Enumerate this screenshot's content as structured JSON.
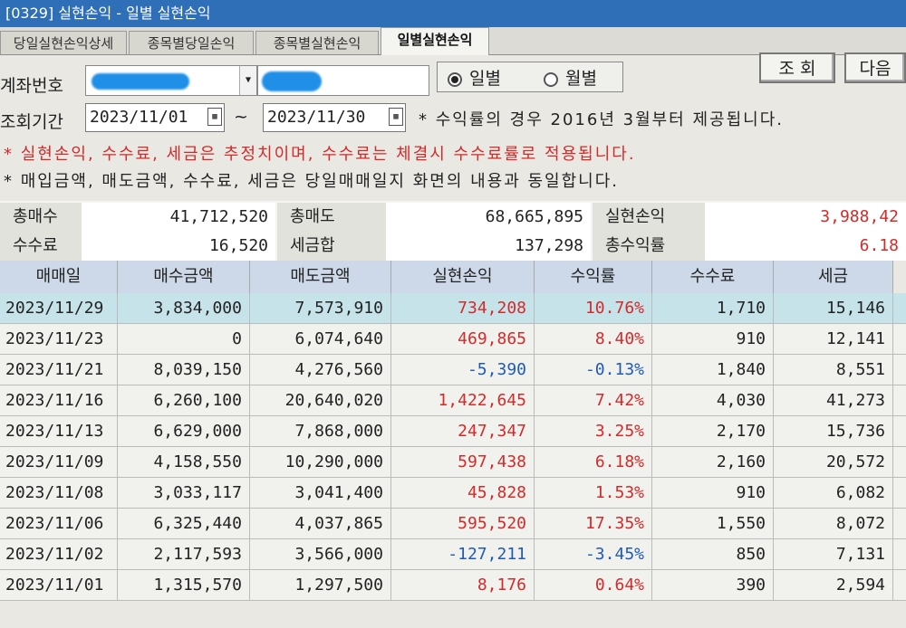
{
  "window": {
    "title": "[0329] 실현손익 - 일별 실현손익"
  },
  "tabs": [
    {
      "label": "당일실현손익상세",
      "active": false
    },
    {
      "label": "종목별당일손익",
      "active": false
    },
    {
      "label": "종목별실현손익",
      "active": false
    },
    {
      "label": "일별실현손익",
      "active": true
    }
  ],
  "form": {
    "account_label": "계좌번호",
    "period_label": "조회기간",
    "date_from": "2023/11/01",
    "date_sep": "~",
    "date_to": "2023/11/30",
    "radio_daily": "일별",
    "radio_monthly": "월별",
    "search_button": "조 회",
    "next_button": "다음",
    "note_yield": "* 수익률의 경우 2016년 3월부터 제공됩니다.",
    "note_realized": "* 실현손익, 수수료, 세금은 추정치이며, 수수료는 체결시 수수료률로 적용됩니다.",
    "note_amounts": "* 매입금액, 매도금액, 수수료, 세금은 당일매매일지 화면의 내용과 동일합니다."
  },
  "summary": {
    "total_buy_label": "총매수",
    "total_buy": "41,712,520",
    "total_sell_label": "총매도",
    "total_sell": "68,665,895",
    "realized_label": "실현손익",
    "realized": "3,988,42",
    "fee_label": "수수료",
    "fee": "16,520",
    "tax_label": "세금합",
    "tax": "137,298",
    "yield_label": "총수익률",
    "yield": "6.18"
  },
  "table": {
    "headers": [
      "매매일",
      "매수금액",
      "매도금액",
      "실현손익",
      "수익률",
      "수수료",
      "세금"
    ],
    "rows": [
      [
        "2023/11/29",
        "3,834,000",
        "7,573,910",
        "734,208",
        "10.76%",
        "1,710",
        "15,146"
      ],
      [
        "2023/11/23",
        "0",
        "6,074,640",
        "469,865",
        "8.40%",
        "910",
        "12,141"
      ],
      [
        "2023/11/21",
        "8,039,150",
        "4,276,560",
        "-5,390",
        "-0.13%",
        "1,840",
        "8,551"
      ],
      [
        "2023/11/16",
        "6,260,100",
        "20,640,020",
        "1,422,645",
        "7.42%",
        "4,030",
        "41,273"
      ],
      [
        "2023/11/13",
        "6,629,000",
        "7,868,000",
        "247,347",
        "3.25%",
        "2,170",
        "15,736"
      ],
      [
        "2023/11/09",
        "4,158,550",
        "10,290,000",
        "597,438",
        "6.18%",
        "2,160",
        "20,572"
      ],
      [
        "2023/11/08",
        "3,033,117",
        "3,041,400",
        "45,828",
        "1.53%",
        "910",
        "6,082"
      ],
      [
        "2023/11/06",
        "6,325,440",
        "4,037,865",
        "595,520",
        "17.35%",
        "1,550",
        "8,072"
      ],
      [
        "2023/11/02",
        "2,117,593",
        "3,566,000",
        "-127,211",
        "-3.45%",
        "850",
        "7,131"
      ],
      [
        "2023/11/01",
        "1,315,570",
        "1,297,500",
        "8,176",
        "0.64%",
        "390",
        "2,594"
      ]
    ]
  },
  "colors": {
    "positive": "#d32a2a",
    "negative": "#1f5bb5",
    "title_bar": "#2f6fb8"
  }
}
